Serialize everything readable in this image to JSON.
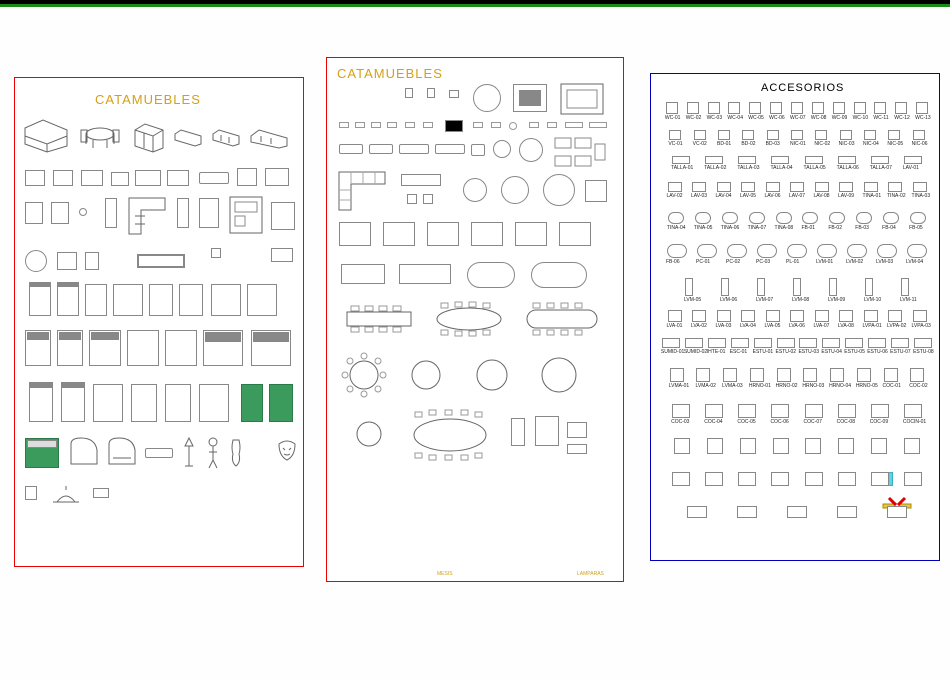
{
  "panels": {
    "left": {
      "title": "CATAMUEBLES",
      "border": "red"
    },
    "center": {
      "title": "CATAMUEBLES",
      "border": "red"
    },
    "right": {
      "title": "ACCESORIOS",
      "border": "blue"
    }
  },
  "notes": {
    "center_bottom_left": "MESIS",
    "center_bottom_right": "LAMPARAS"
  },
  "accessory_labels": [
    "WC-01",
    "WC-02",
    "WC-03",
    "WC-04",
    "WC-05",
    "WC-06",
    "WC-07",
    "WC-08",
    "WC-09",
    "WC-10",
    "WC-11",
    "WC-12",
    "WC-13",
    "VC-01",
    "VC-02",
    "BD-01",
    "BD-02",
    "BD-03",
    "NIC-01",
    "NIC-02",
    "NIC-03",
    "NIC-04",
    "NIC-05",
    "NIC-06",
    "TALLA-01",
    "TALLA-02",
    "TALLA-03",
    "TALLA-04",
    "TALLA-05",
    "TALLA-06",
    "TALLA-07",
    "LAV-01",
    "LAV-02",
    "LAV-03",
    "LAV-04",
    "LAV-05",
    "LAV-06",
    "LAV-07",
    "LAV-08",
    "LAV-09",
    "TINA-01",
    "TINA-02",
    "TINA-03",
    "TINA-04",
    "TINA-05",
    "TINA-06",
    "TINA-07",
    "TINA-08",
    "FB-01",
    "FB-02",
    "FB-03",
    "FB-04",
    "FB-05",
    "FB-06",
    "PC-01",
    "PC-02",
    "PC-03",
    "PL-01",
    "LVM-01",
    "LVM-02",
    "LVM-03",
    "LVM-04",
    "LVM-05",
    "LVM-06",
    "LVM-07",
    "LVM-08",
    "LVM-09",
    "LVM-10",
    "LVM-11",
    "LVA-01",
    "LVA-02",
    "LVA-03",
    "LVA-04",
    "LVA-05",
    "LVA-06",
    "LVA-07",
    "LVA-08",
    "LVPA-01",
    "LVPA-02",
    "LVPA-03",
    "SUMID-01",
    "SUMID-02",
    "IHTE-01",
    "ESC-01",
    "ESTU-01",
    "ESTU-02",
    "ESTU-03",
    "ESTU-04",
    "ESTU-05",
    "ESTU-06",
    "ESTU-07",
    "ESTU-08",
    "LVMA-01",
    "LVMA-02",
    "LVMA-03",
    "HRNO-01",
    "HRNO-02",
    "HRNO-03",
    "HRNO-04",
    "HRNO-05",
    "COC-01",
    "COC-02",
    "COC-03",
    "COC-04",
    "COC-05",
    "COC-06",
    "COC-07",
    "COC-08",
    "COC-09",
    "COCIN-01"
  ],
  "accent_colors": {
    "green_fill": "#3a9b5c",
    "cyan_fill": "#5ad5e8",
    "yellow_fill": "#eedd55",
    "gold_text": "#d4a017"
  }
}
